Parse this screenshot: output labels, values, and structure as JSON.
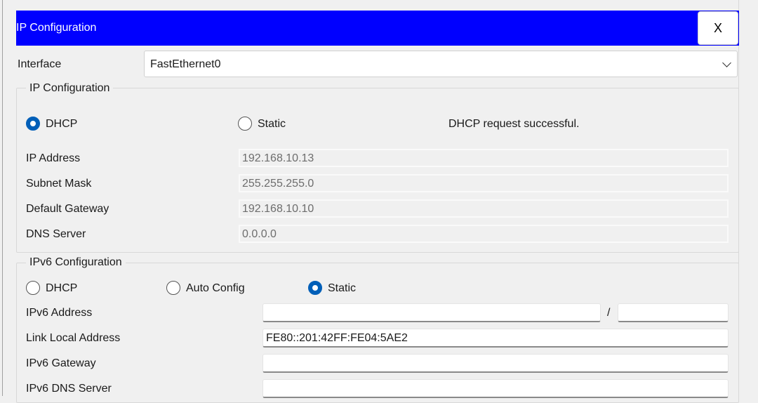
{
  "window": {
    "title": "IP Configuration",
    "close_label": "X"
  },
  "interface": {
    "label": "Interface",
    "value": "FastEthernet0"
  },
  "ipv4": {
    "legend": "IP Configuration",
    "dhcp_label": "DHCP",
    "static_label": "Static",
    "mode": "DHCP",
    "status": "DHCP request successful.",
    "fields": [
      {
        "label": "IP Address",
        "value": "192.168.10.13"
      },
      {
        "label": "Subnet Mask",
        "value": "255.255.255.0"
      },
      {
        "label": "Default Gateway",
        "value": "192.168.10.10"
      },
      {
        "label": "DNS Server",
        "value": "0.0.0.0"
      }
    ]
  },
  "ipv6": {
    "legend": "IPv6 Configuration",
    "dhcp_label": "DHCP",
    "auto_label": "Auto Config",
    "static_label": "Static",
    "mode": "Static",
    "address_label": "IPv6 Address",
    "address_value": "",
    "prefix_separator": "/",
    "prefix_value": "",
    "link_local_label": "Link Local Address",
    "link_local_value": "FE80::201:42FF:FE04:5AE2",
    "gateway_label": "IPv6 Gateway",
    "gateway_value": "",
    "dns_label": "IPv6 DNS Server",
    "dns_value": ""
  }
}
